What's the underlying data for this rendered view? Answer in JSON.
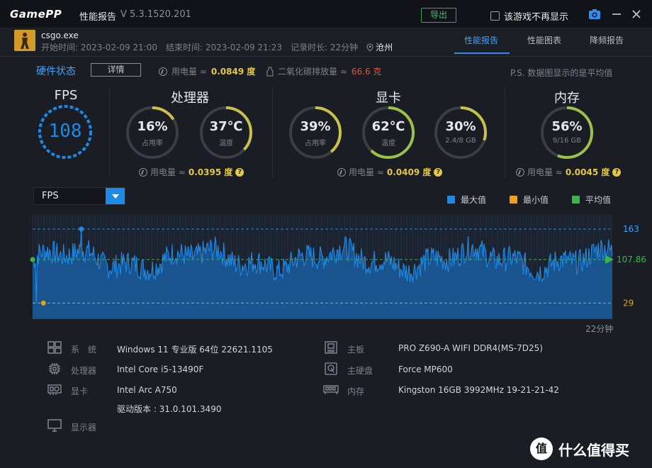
{
  "titlebar": {
    "logo_a": "Game",
    "logo_b": "PP",
    "title": "性能报告",
    "version": "V 5.3.1520.201",
    "export_label": "导出",
    "no_show_label": "该游戏不再显示"
  },
  "session": {
    "game": "csgo.exe",
    "start": "开始时间: 2023-02-09 21:00",
    "end": "结束时间: 2023-02-09 21:23",
    "duration": "记录时长: 22分钟",
    "location": "沧州"
  },
  "tabs": [
    "性能报告",
    "性能图表",
    "降频报告"
  ],
  "hardware": {
    "title": "硬件状态",
    "detail_label": "详情",
    "total_power_label": "用电量 ≈",
    "total_power_value": "0.0849 度",
    "carbon_label": "二氧化碳排放量 ≈",
    "carbon_value": "66.6 克",
    "note": "P.S. 数据图显示的是平均值"
  },
  "fps": {
    "title": "FPS",
    "value": "108"
  },
  "cpu": {
    "title": "处理器",
    "usage": "16%",
    "usage_label": "占用率",
    "usage_pct": 16,
    "temp": "37℃",
    "temp_label": "温度",
    "temp_pct": 37,
    "power_label": "用电量 ≈",
    "power_value": "0.0395 度"
  },
  "gpu": {
    "title": "显卡",
    "usage": "39%",
    "usage_label": "占用率",
    "usage_pct": 39,
    "temp": "62℃",
    "temp_label": "温度",
    "temp_pct": 62,
    "vram": "30%",
    "vram_label": "2.4/8 GB",
    "vram_pct": 30,
    "power_label": "用电量 ≈",
    "power_value": "0.0409 度"
  },
  "memory": {
    "title": "内存",
    "usage": "56%",
    "usage_label": "9/16 GB",
    "usage_pct": 56,
    "power_label": "用电量 ≈",
    "power_value": "0.0045 度"
  },
  "chart": {
    "metric": "FPS",
    "legend_max": "最大值",
    "legend_min": "最小值",
    "legend_avg": "平均值",
    "color_max": "#1e8ae8",
    "color_min": "#f0a020",
    "color_avg": "#3cb44b",
    "duration_label": "22分钟"
  },
  "chart_data": {
    "type": "area",
    "series": [
      {
        "name": "FPS"
      }
    ],
    "max_label": "163",
    "avg_label": "107.86",
    "min_label": "29",
    "max": 163,
    "avg": 107.86,
    "min": 29,
    "xlabel": "22分钟"
  },
  "specs": {
    "os_label": "系　统",
    "os_value": "Windows 11 专业版 64位 22621.1105",
    "cpu_label": "处理器",
    "cpu_value": "Intel Core i5-13490F",
    "gpu_label": "显卡",
    "gpu_value": "Intel Arc A750",
    "driver_value": "驱动版本 : 31.0.101.3490",
    "display_label": "显示器",
    "board_label": "主板",
    "board_value": "PRO Z690-A WIFI DDR4(MS-7D25)",
    "disk_label": "主硬盘",
    "disk_value": "Force MP600",
    "mem_label": "内存",
    "mem_value": "Kingston 16GB 3992MHz 19-21-21-42"
  },
  "watermark": {
    "badge": "值",
    "text": "什么值得买"
  }
}
